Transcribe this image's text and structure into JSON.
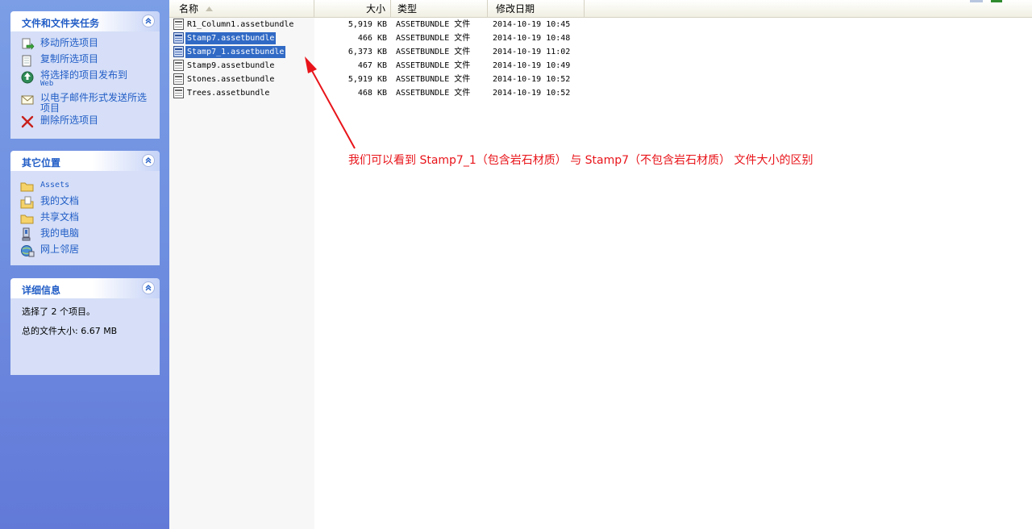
{
  "task_pane": {
    "file_tasks": {
      "title": "文件和文件夹任务",
      "items": [
        {
          "label": "移动所选项目",
          "sub": "",
          "icon": "move-icon"
        },
        {
          "label": "复制所选项目",
          "sub": "",
          "icon": "copy-icon"
        },
        {
          "label": "将选择的项目发布到",
          "sub": "Web",
          "icon": "publish-web-icon"
        },
        {
          "label": "以电子邮件形式发送所选项目",
          "sub": "",
          "icon": "email-icon"
        },
        {
          "label": "删除所选项目",
          "sub": "",
          "icon": "delete-icon"
        }
      ]
    },
    "other_places": {
      "title": "其它位置",
      "items": [
        {
          "label": "Assets",
          "icon": "folder-icon"
        },
        {
          "label": "我的文档",
          "icon": "my-documents-icon"
        },
        {
          "label": "共享文档",
          "icon": "folder-icon"
        },
        {
          "label": "我的电脑",
          "icon": "my-computer-icon"
        },
        {
          "label": "网上邻居",
          "icon": "network-icon"
        }
      ]
    },
    "details": {
      "title": "详细信息",
      "selected_text": "选择了 2 个项目。",
      "total_size_text": "总的文件大小: 6.67 MB"
    }
  },
  "file_list": {
    "columns": [
      "名称",
      "大小",
      "类型",
      "修改日期"
    ],
    "rows": [
      {
        "name": "R1_Column1.assetbundle",
        "size": "5,919 KB",
        "type": "ASSETBUNDLE 文件",
        "date": "2014-10-19 10:45",
        "selected": false
      },
      {
        "name": "Stamp7.assetbundle",
        "size": "466 KB",
        "type": "ASSETBUNDLE 文件",
        "date": "2014-10-19 10:48",
        "selected": true
      },
      {
        "name": "Stamp7_1.assetbundle",
        "size": "6,373 KB",
        "type": "ASSETBUNDLE 文件",
        "date": "2014-10-19 11:02",
        "selected": true
      },
      {
        "name": "Stamp9.assetbundle",
        "size": "467 KB",
        "type": "ASSETBUNDLE 文件",
        "date": "2014-10-19 10:49",
        "selected": false
      },
      {
        "name": "Stones.assetbundle",
        "size": "5,919 KB",
        "type": "ASSETBUNDLE 文件",
        "date": "2014-10-19 10:52",
        "selected": false
      },
      {
        "name": "Trees.assetbundle",
        "size": "468 KB",
        "type": "ASSETBUNDLE 文件",
        "date": "2014-10-19 10:52",
        "selected": false
      }
    ]
  },
  "annotation": {
    "text": "我们可以看到 Stamp7_1（包含岩石材质） 与 Stamp7（不包含岩石材质） 文件大小的区别",
    "color": "#e8141a"
  },
  "colors": {
    "selection": "#316ac5",
    "task_link": "#215dc6",
    "pane_bg": "#6f8fe0"
  }
}
